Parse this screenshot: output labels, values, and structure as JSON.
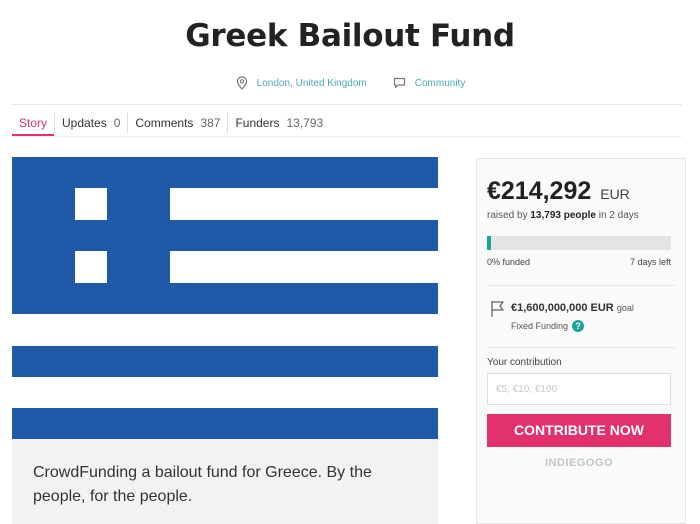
{
  "campaign": {
    "title": "Greek Bailout Fund",
    "location": "London, United Kingdom",
    "category": "Community"
  },
  "tabs": [
    {
      "label": "Story",
      "count": ""
    },
    {
      "label": "Updates",
      "count": "0"
    },
    {
      "label": "Comments",
      "count": "387"
    },
    {
      "label": "Funders",
      "count": "13,793"
    }
  ],
  "story": {
    "text": "CrowdFunding a bailout fund for Greece. By the people, for the people."
  },
  "funding": {
    "amount": "€214,292",
    "currency": "EUR",
    "raised_prefix": "raised by",
    "people": "13,793 people",
    "raised_suffix": "in 2 days",
    "percent_label": "0% funded",
    "progress_fraction": 0.02,
    "days_left": "7 days left",
    "goal_amount": "€1,600,000,000",
    "goal_currency": "EUR",
    "goal_word": "goal",
    "funding_type": "Fixed Funding",
    "help_glyph": "?"
  },
  "contribution": {
    "label": "Your contribution",
    "placeholder": "€5, €10, €100",
    "button": "CONTRIBUTE NOW",
    "brand": "INDIEGOGO"
  },
  "icons": {
    "location": "location-pin-icon",
    "category": "speech-bubble-icon",
    "goal": "flag-icon",
    "help": "help-circle-icon"
  },
  "colors": {
    "accent": "#e2316e",
    "teal": "#1aa59b",
    "link": "#4aa7b5",
    "flag_blue": "#1f5aa8"
  }
}
